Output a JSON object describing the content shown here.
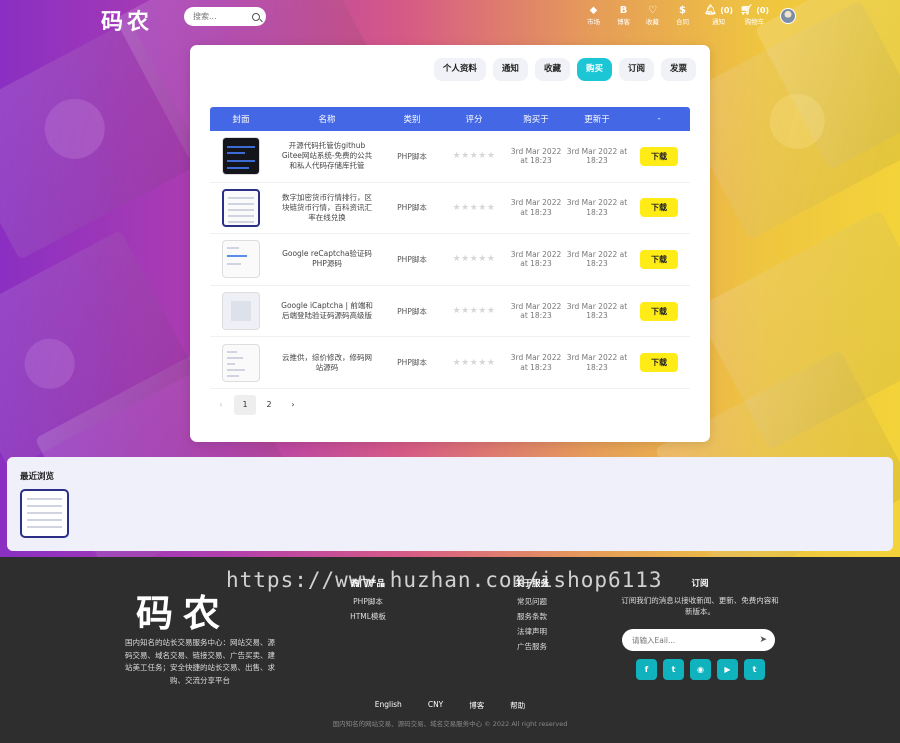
{
  "brand": {
    "logo": "码农"
  },
  "search": {
    "placeholder": "搜索..."
  },
  "nav": [
    {
      "glyph": "⬥",
      "label": "市场",
      "icon": "tag-icon"
    },
    {
      "glyph": "B",
      "label": "博客",
      "icon": "bitcoin-icon"
    },
    {
      "glyph": "♡",
      "label": "收藏",
      "icon": "heart-icon"
    },
    {
      "glyph": "$",
      "label": "合同",
      "icon": "dollar-icon"
    },
    {
      "glyph": "🔔︎",
      "label": "通知",
      "badge": "(0)",
      "icon": "bell-icon"
    },
    {
      "glyph": "🛒︎",
      "label": "购物车",
      "badge": "(0)",
      "icon": "cart-icon"
    }
  ],
  "tabs": [
    {
      "label": "个人资料",
      "active": false
    },
    {
      "label": "通知",
      "active": false
    },
    {
      "label": "收藏",
      "active": false
    },
    {
      "label": "购买",
      "active": true
    },
    {
      "label": "订阅",
      "active": false
    },
    {
      "label": "发票",
      "active": false
    }
  ],
  "table": {
    "headers": [
      "封面",
      "名称",
      "类别",
      "评分",
      "购买于",
      "更新于",
      "-"
    ],
    "rows": [
      {
        "name": "开源代码托管仿github Gitee网站系统-免费的公共和私人代码存储库托管",
        "category": "PHP脚本",
        "rating": "★★★★★",
        "purchased": "3rd Mar 2022 at 18:23",
        "updated": "3rd Mar 2022 at 18:23",
        "action": "下载",
        "thumb": "dark"
      },
      {
        "name": "数字加密货币行情排行，区块链货币行情，百科资讯汇率在线兑换",
        "category": "PHP脚本",
        "rating": "★★★★★",
        "purchased": "3rd Mar 2022 at 18:23",
        "updated": "3rd Mar 2022 at 18:23",
        "action": "下载",
        "thumb": "blue"
      },
      {
        "name": "Google reCaptcha验证码PHP源码",
        "category": "PHP脚本",
        "rating": "★★★★★",
        "purchased": "3rd Mar 2022 at 18:23",
        "updated": "3rd Mar 2022 at 18:23",
        "action": "下载",
        "thumb": "light"
      },
      {
        "name": "Google iCaptcha | 前端和后端登陆验证码源码高级版",
        "category": "PHP脚本",
        "rating": "★★★★★",
        "purchased": "3rd Mar 2022 at 18:23",
        "updated": "3rd Mar 2022 at 18:23",
        "action": "下载",
        "thumb": "light"
      },
      {
        "name": "云推供，综价修改，修码网站源码",
        "category": "PHP脚本",
        "rating": "★★★★★",
        "purchased": "3rd Mar 2022 at 18:23",
        "updated": "3rd Mar 2022 at 18:23",
        "action": "下载",
        "thumb": "light"
      }
    ]
  },
  "pager": {
    "prev": "‹",
    "pages": [
      "1",
      "2"
    ],
    "next": "›",
    "current": "1"
  },
  "recent": {
    "title": "最近浏览"
  },
  "footer": {
    "logo": "码农",
    "description": "国内知名的站长交易服务中心：网站交易、源码交易、域名交易、链接交易、广告买卖、建站美工任务；安全快捷的站长交易、出售、求购、交流分享平台",
    "col1": {
      "title": "热门产品",
      "items": [
        "PHP脚本",
        "HTML模板"
      ]
    },
    "col2": {
      "title": "关于服务",
      "items": [
        "常见问题",
        "服务条款",
        "法律声明",
        "广告服务"
      ]
    },
    "subscribe": {
      "title": "订阅",
      "desc": "订阅我们的消息以接收新闻、更新、免费内容和新版本。",
      "placeholder": "请输入Eail..."
    },
    "socials": [
      {
        "glyph": "f",
        "icon": "facebook-icon"
      },
      {
        "glyph": "t",
        "icon": "twitter-icon"
      },
      {
        "glyph": "◉",
        "icon": "dribbble-icon"
      },
      {
        "glyph": "▶",
        "icon": "youtube-icon"
      },
      {
        "glyph": "t",
        "icon": "tumblr-icon"
      }
    ],
    "links": [
      "English",
      "CNY",
      "博客",
      "帮助"
    ],
    "copyright": "国内知名的网站交易、源码交易、域名交易服务中心 © 2022 All right reserved"
  },
  "watermark": "https://www.huzhan.com/ishop6113"
}
